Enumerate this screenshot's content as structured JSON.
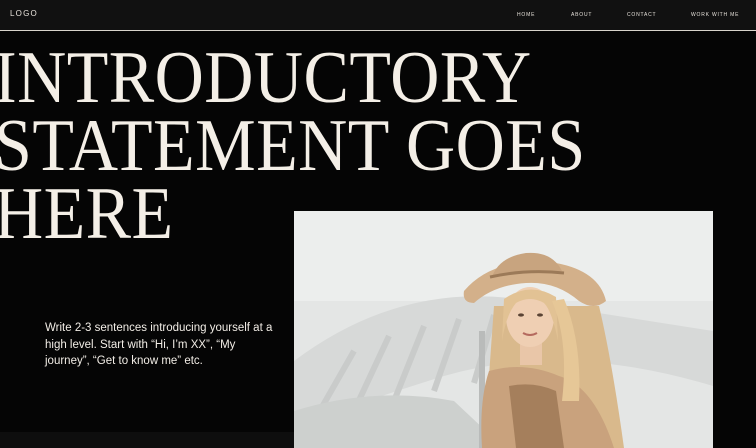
{
  "header": {
    "logo": "LOGO",
    "nav": [
      {
        "label": "HOME"
      },
      {
        "label": "ABOUT"
      },
      {
        "label": "CONTACT"
      },
      {
        "label": "WORK WITH ME"
      }
    ]
  },
  "hero": {
    "headline_lines": [
      "INTRODUCTORY",
      "STATEMENT GOES",
      "HERE"
    ],
    "intro": "Write 2-3 sentences introducing yourself at a high level. Start with “Hi, I’m XX”, “My journey”, “Get to know me” etc."
  },
  "colors": {
    "background": "#050505",
    "header_background": "#111111",
    "text": "#f2ede6"
  },
  "photo": {
    "icon": "woman-in-hat-photo"
  }
}
